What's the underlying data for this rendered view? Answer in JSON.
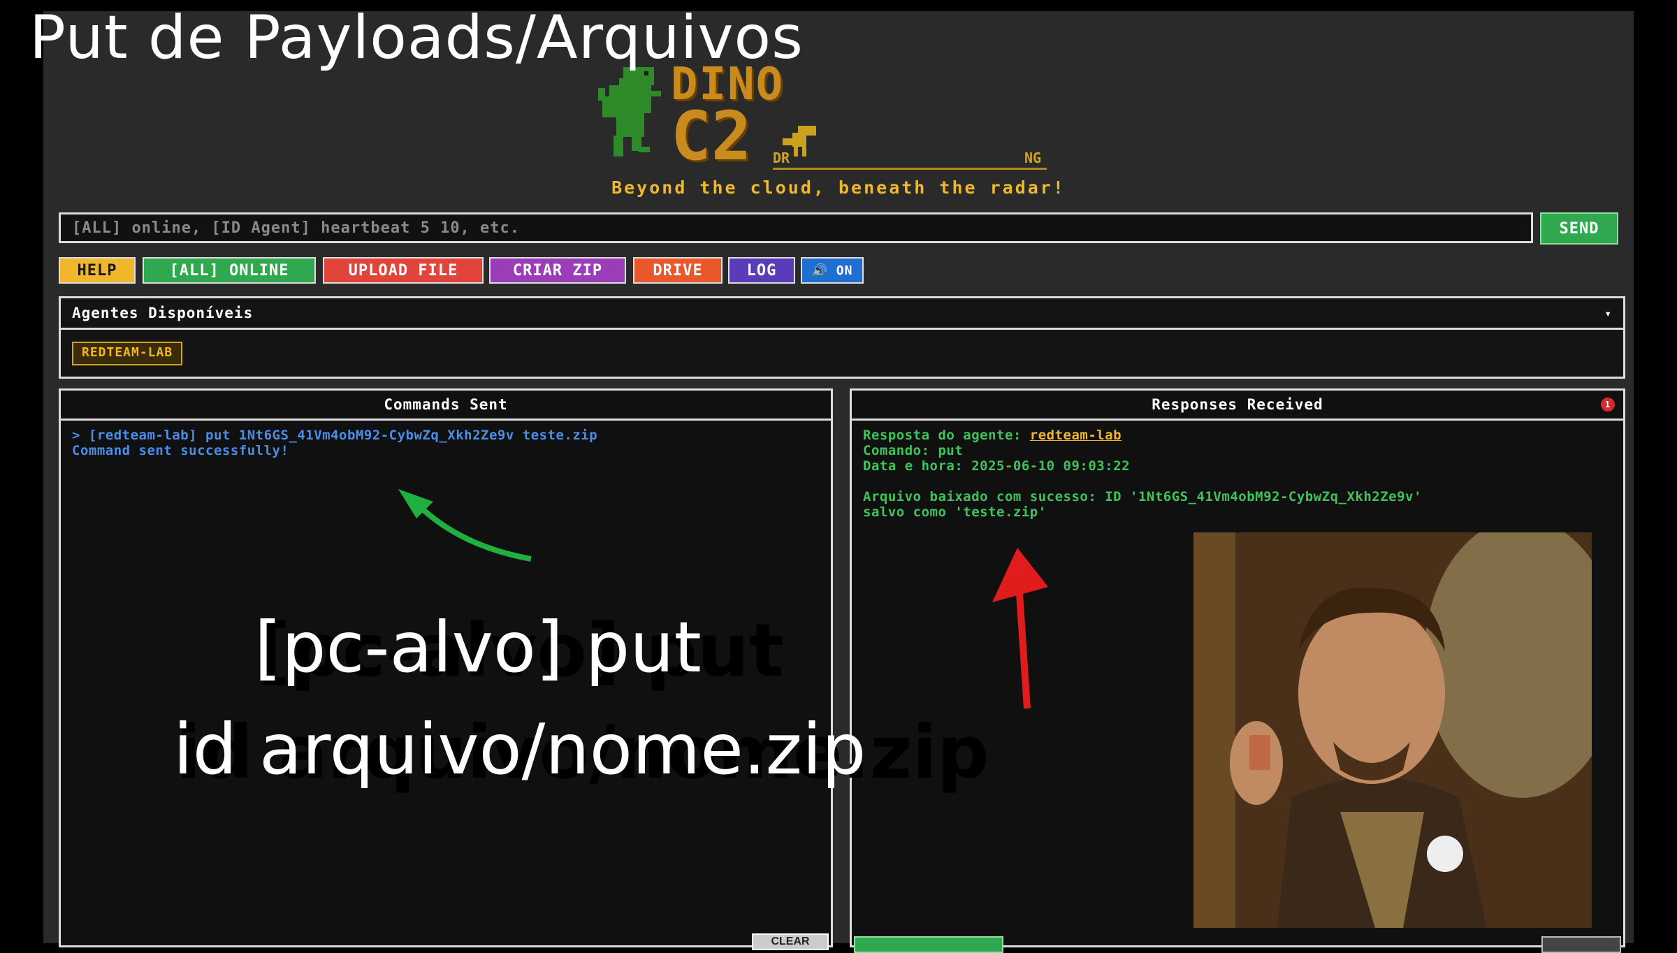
{
  "slide_title": "Put de Payloads/Arquivos",
  "logo": {
    "dino": "DINO",
    "c2": "C2",
    "dr": "DR",
    "ng": "NG"
  },
  "tagline": "Beyond the cloud, beneath the radar!",
  "command_input": {
    "placeholder": "[ALL] online, [ID Agent] heartbeat 5 10, etc.",
    "value": ""
  },
  "send_label": "SEND",
  "toolbar": {
    "help": "HELP",
    "all_online": "[ALL] ONLINE",
    "upload_file": "UPLOAD FILE",
    "criar_zip": "CRIAR ZIP",
    "drive": "DRIVE",
    "log": "LOG",
    "sound": "🔊 ON"
  },
  "agents_panel": {
    "title": "Agentes Disponíveis",
    "toggle": "▾",
    "agents": [
      "REDTEAM-LAB"
    ]
  },
  "commands_panel": {
    "title": "Commands Sent",
    "line1": "> [redteam-lab] put 1Nt6GS_41Vm4obM92-CybwZq_Xkh2Ze9v teste.zip",
    "line2": "Command sent successfully!",
    "clear": "CLEAR"
  },
  "responses_panel": {
    "title": "Responses Received",
    "badge": "1",
    "agent_prefix": "Resposta do agente: ",
    "agent_name": "redteam-lab",
    "comando": "Comando: put",
    "data_hora": "Data e hora: 2025-06-10 09:03:22",
    "result1": "Arquivo baixado com sucesso: ID '1Nt6GS_41Vm4obM92-CybwZq_Xkh2Ze9v'",
    "result2": "salvo como 'teste.zip'"
  },
  "overlay": {
    "line1": "[pc-alvo] put",
    "line2": "id arquivo/nome.zip"
  },
  "colors": {
    "help": "#f0b72c",
    "online": "#2fa84f",
    "upload": "#e0443a",
    "zip": "#9b3cb8",
    "drive": "#e8582a",
    "log": "#5b3cb8",
    "sound": "#1f6fd0"
  }
}
